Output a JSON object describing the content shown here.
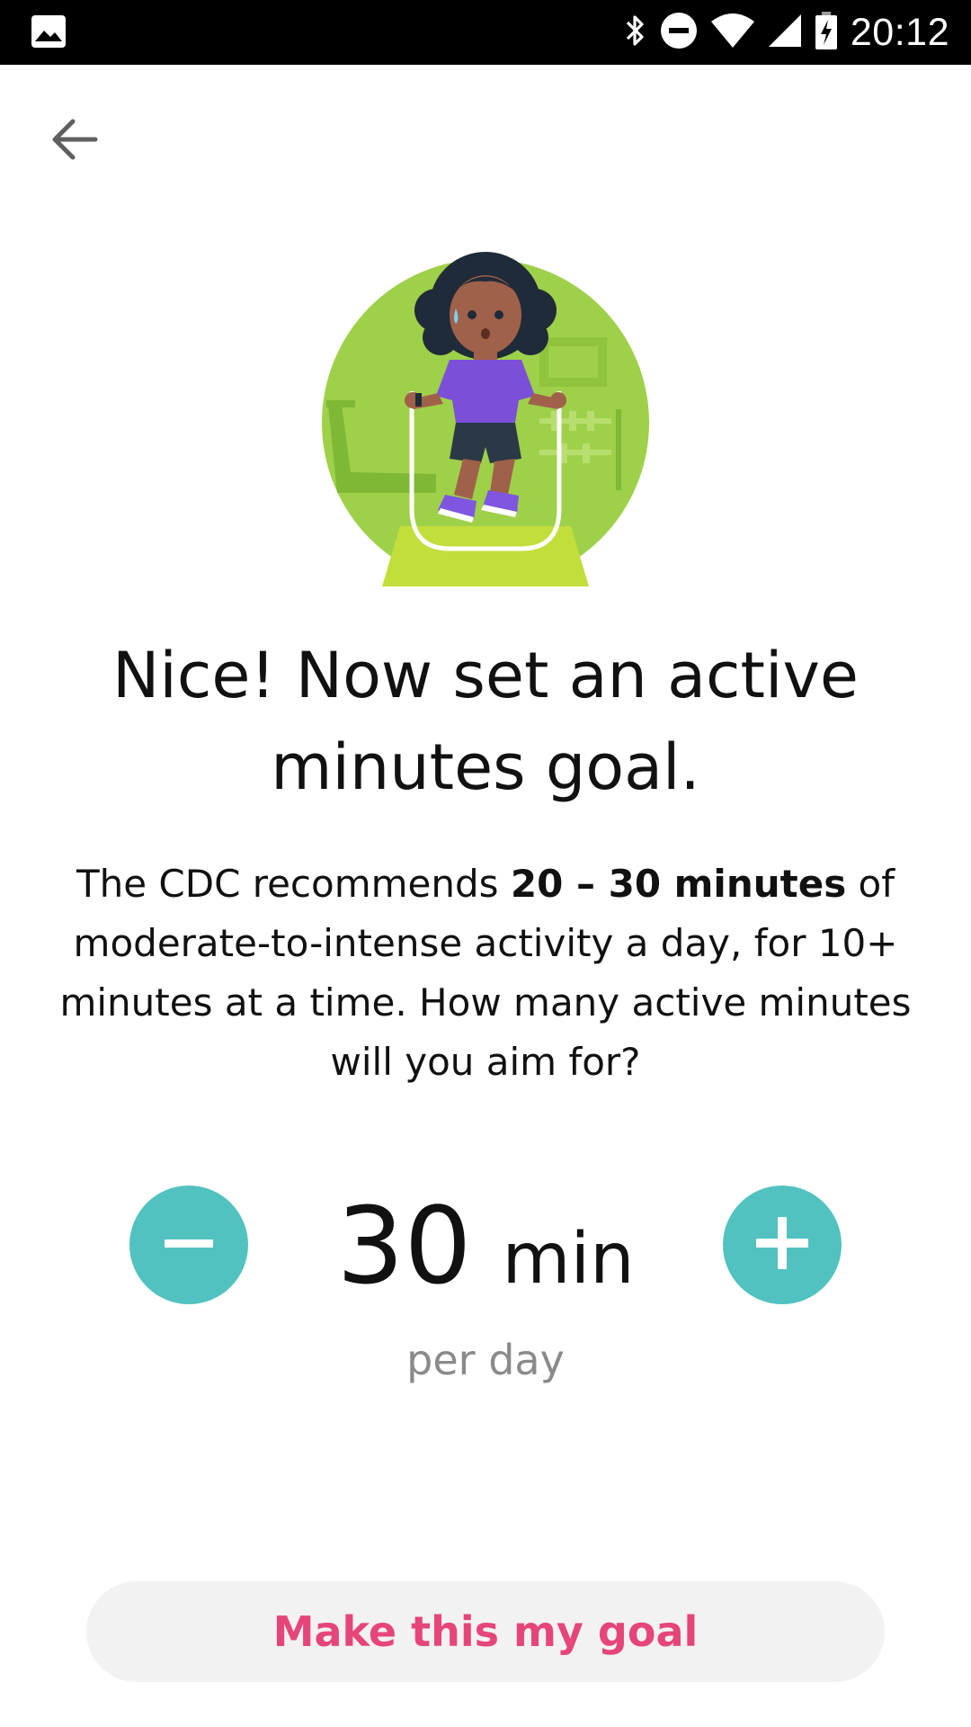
{
  "status_bar": {
    "time": "20:12",
    "icons": [
      "image-icon",
      "bluetooth-icon",
      "do-not-disturb-icon",
      "wifi-icon",
      "cell-signal-icon",
      "battery-charging-icon"
    ]
  },
  "nav": {
    "back_icon": "arrow-left-icon"
  },
  "illustration": {
    "name": "jump-rope-illustration",
    "colors": {
      "circle": "#9fd04a",
      "skin": "#a0614a",
      "hair": "#1f2b38",
      "shirt": "#7b4fd8",
      "shorts": "#2b3946",
      "shoes": "#7f56e0",
      "rope": "#ffffff"
    }
  },
  "headline": {
    "line1": "Nice! Now set an active",
    "line2": "minutes goal."
  },
  "body": {
    "part1": "The CDC recommends ",
    "bold": "20 – 30 minutes",
    "part2": " of moderate-to-intense activity a day, for 10+ minutes at a time. How many active minutes will you aim for?"
  },
  "stepper": {
    "value": "30",
    "unit": "min",
    "sub_label": "per day",
    "decrement_icon": "minus-icon",
    "increment_icon": "plus-icon"
  },
  "cta": {
    "label": "Make this my goal"
  },
  "colors": {
    "accent_teal": "#51c2c0",
    "cta_text": "#e6457a",
    "cta_bg": "#f2f2f2",
    "muted_text": "#8a8a8a"
  }
}
